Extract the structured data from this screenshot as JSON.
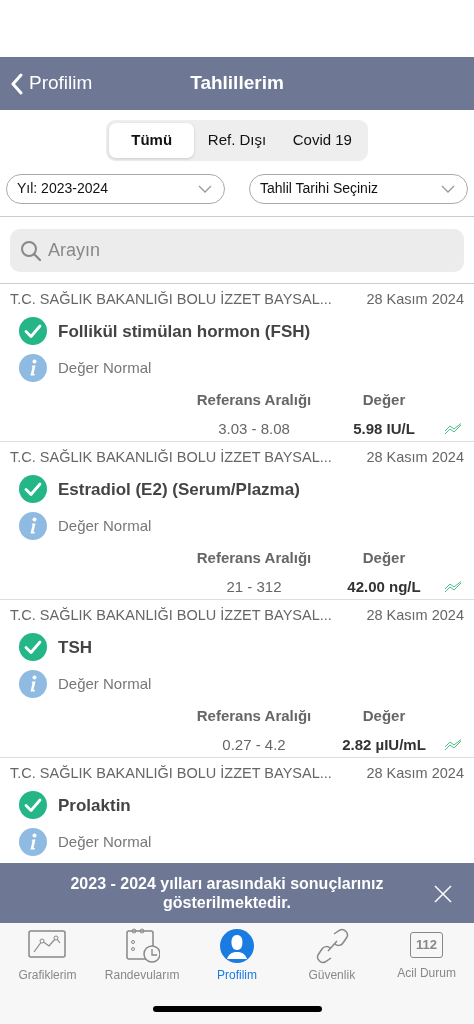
{
  "header": {
    "back_label": "Profilim",
    "title": "Tahlillerim"
  },
  "segments": [
    {
      "label": "Tümü",
      "selected": true
    },
    {
      "label": "Ref. Dışı",
      "selected": false
    },
    {
      "label": "Covid 19",
      "selected": false
    }
  ],
  "filters": [
    {
      "value": "Yıl: 2023-2024"
    },
    {
      "value": "Tahlil Tarihi Seçiniz"
    }
  ],
  "search": {
    "placeholder": "Arayın"
  },
  "results": [
    {
      "institution": "T.C. SAĞLIK BAKANLIĞI BOLU İZZET BAYSAL...",
      "date": "28 Kasım 2024",
      "test": "Follikül stimülan hormon (FSH)",
      "status": "Değer Normal",
      "range_label": "Referans Aralığı",
      "value_label": "Değer",
      "range": "3.03 - 8.08",
      "value": "5.98 IU/L"
    },
    {
      "institution": "T.C. SAĞLIK BAKANLIĞI BOLU İZZET BAYSAL...",
      "date": "28 Kasım 2024",
      "test": "Estradiol (E2) (Serum/Plazma)",
      "status": "Değer Normal",
      "range_label": "Referans Aralığı",
      "value_label": "Değer",
      "range": "21 - 312",
      "value": "42.00 ng/L"
    },
    {
      "institution": "T.C. SAĞLIK BAKANLIĞI BOLU İZZET BAYSAL...",
      "date": "28 Kasım 2024",
      "test": "TSH",
      "status": "Değer Normal",
      "range_label": "Referans Aralığı",
      "value_label": "Değer",
      "range": "0.27 - 4.2",
      "value": "2.82 µIU/mL"
    },
    {
      "institution": "T.C. SAĞLIK BAKANLIĞI BOLU İZZET BAYSAL...",
      "date": "28 Kasım 2024",
      "test": "Prolaktin",
      "status": "Değer Normal"
    }
  ],
  "banner": {
    "text": "2023 - 2024 yılları arasındaki sonuçlarınız gösterilmektedir."
  },
  "tabbar": [
    {
      "kind": "chart",
      "label": "Grafiklerim",
      "selected": false
    },
    {
      "kind": "calendar",
      "label": "Randevularım",
      "selected": false
    },
    {
      "kind": "profile",
      "label": "Profilim",
      "selected": true
    },
    {
      "kind": "link",
      "label": "Güvenlik",
      "selected": false
    },
    {
      "kind": "emergency",
      "label": "Acil Durum",
      "badge": "112",
      "selected": false
    }
  ]
}
